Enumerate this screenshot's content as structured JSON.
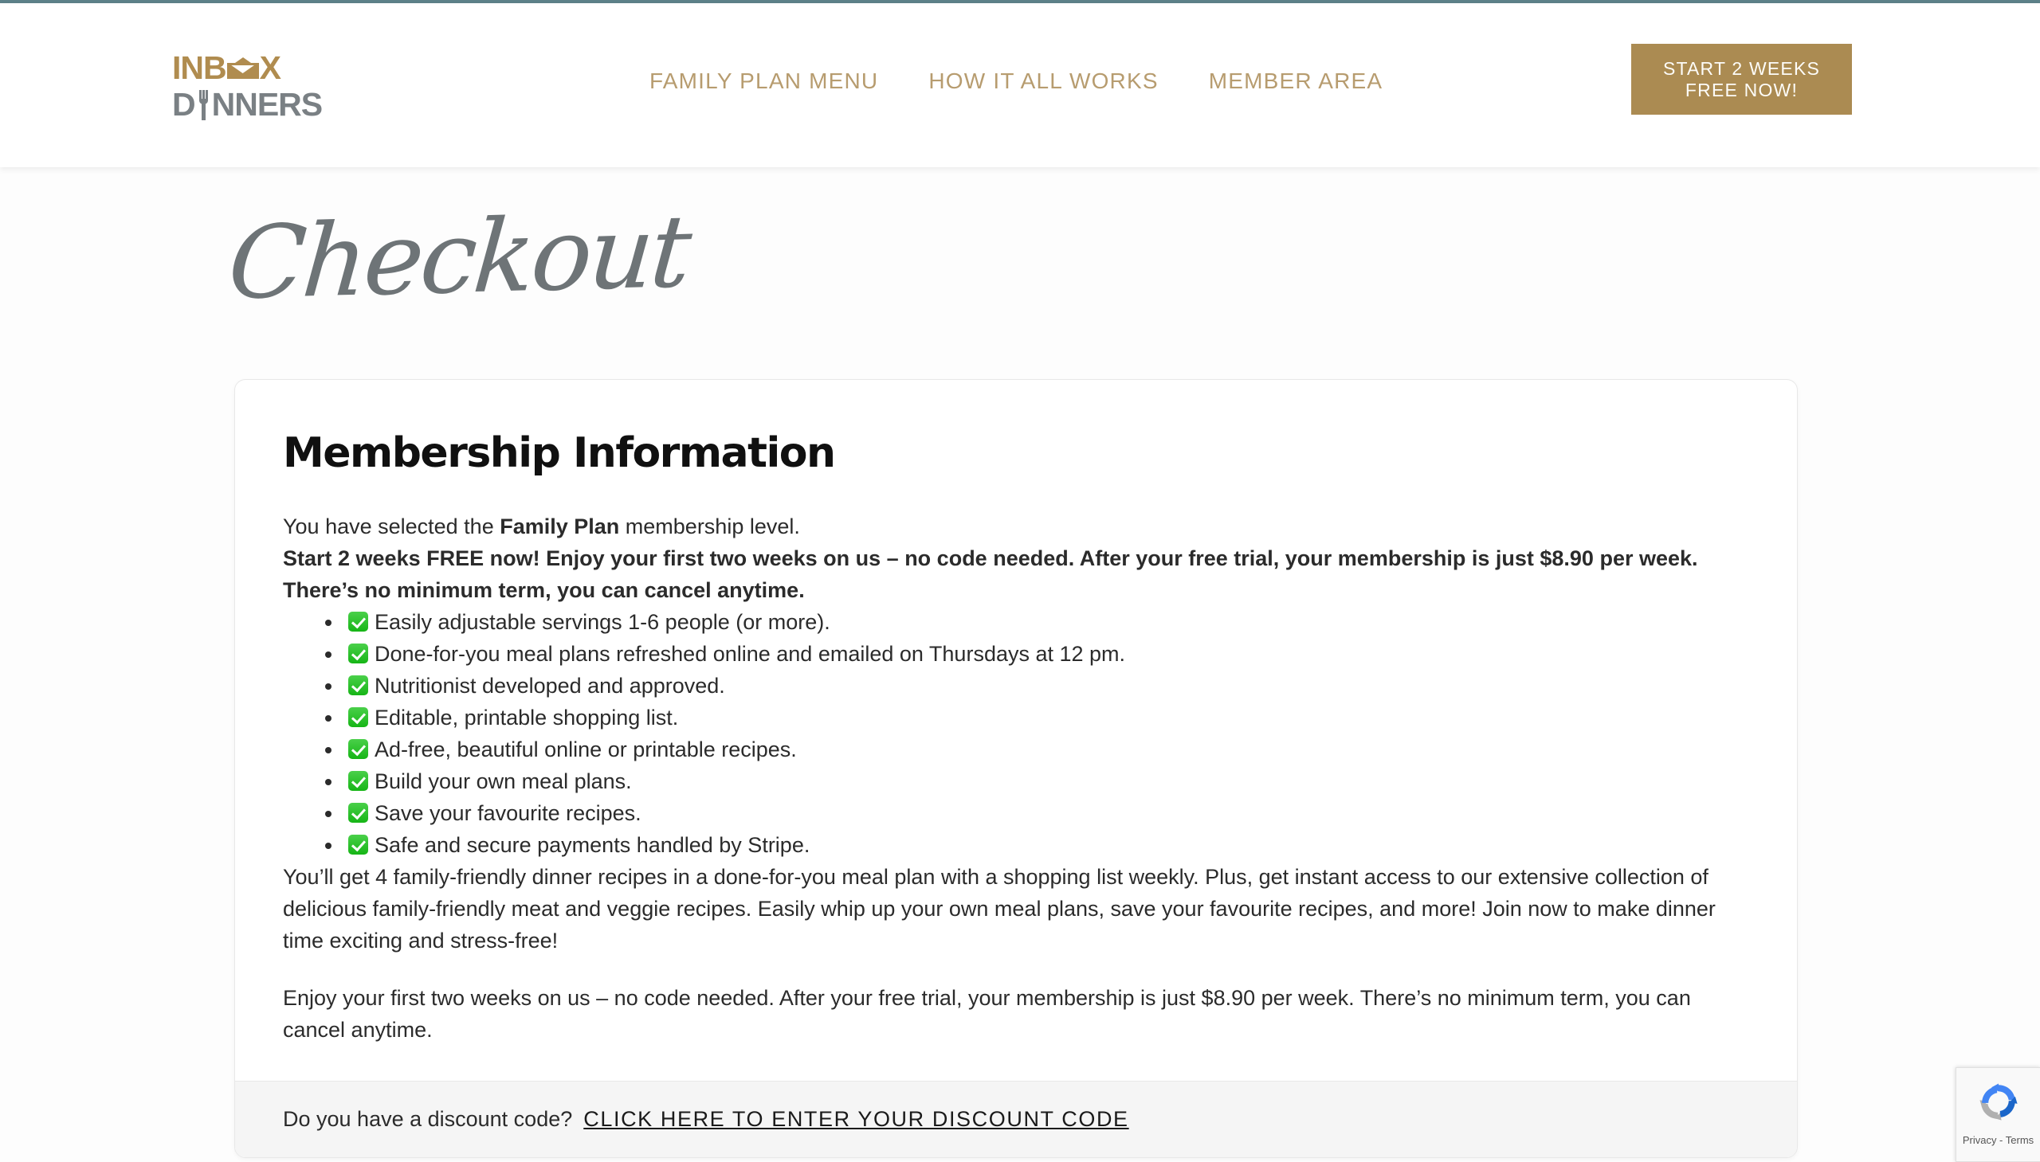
{
  "theme": {
    "gold": "#ab8b52",
    "nav_gold": "#b79c6f",
    "top_strip": "#5d8189",
    "logo_gray": "#7a8084",
    "check_green": "#16b516"
  },
  "header": {
    "logo": {
      "line1_before": "INB",
      "line1_after": "X",
      "line2_before": "D",
      "line2_after": "NNERS",
      "envelope_icon": "envelope-icon",
      "fork_icon": "fork-icon"
    },
    "nav": [
      {
        "label": "FAMILY PLAN MENU"
      },
      {
        "label": "HOW IT ALL WORKS"
      },
      {
        "label": "MEMBER AREA"
      }
    ],
    "cta_label": "START 2 WEEKS FREE NOW!"
  },
  "page": {
    "title": "Checkout"
  },
  "card": {
    "heading": "Membership Information",
    "intro_before": "You have selected the ",
    "intro_plan": "Family Plan",
    "intro_after": " membership level.",
    "highlight": "Start 2 weeks FREE now! Enjoy your first two weeks on us – no code needed. After your free trial, your membership is just $8.90 per week. There’s no minimum term, you can cancel anytime.",
    "features": [
      "Easily adjustable servings 1-6 people (or more).",
      "Done-for-you meal plans refreshed online and emailed on Thursdays at 12 pm.",
      "Nutritionist developed and approved.",
      "Editable, printable shopping list.",
      "Ad-free, beautiful online or printable recipes.",
      "Build your own meal plans.",
      "Save your favourite recipes.",
      "Safe and secure payments handled by Stripe."
    ],
    "paragraph1": "You’ll get 4 family-friendly dinner recipes in a done-for-you meal plan with a shopping list weekly. Plus, get instant access to our extensive collection of delicious family-friendly meat and veggie recipes. Easily whip up your own meal plans, save your favourite recipes, and more! Join now to make dinner time exciting and stress-free!",
    "paragraph2": "Enjoy your first two weeks on us – no code needed. After your free trial, your membership is just $8.90 per week. There’s no minimum term, you can cancel anytime.",
    "footer_question": "Do you have a discount code?",
    "footer_link": "CLICK HERE TO ENTER YOUR DISCOUNT CODE"
  },
  "recaptcha": {
    "text": "Privacy - Terms"
  }
}
